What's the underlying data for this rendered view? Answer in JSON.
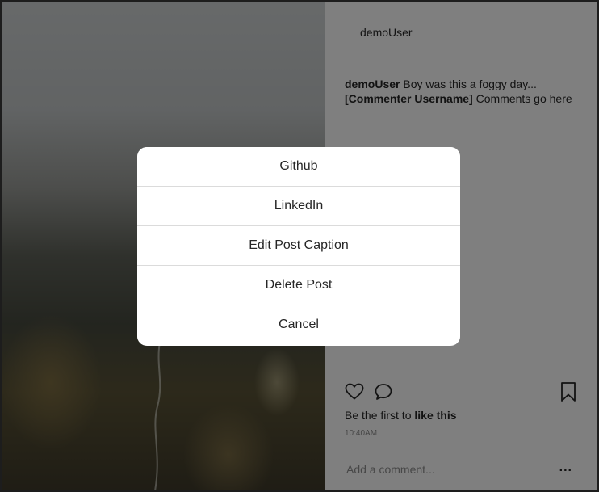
{
  "post": {
    "username": "demoUser",
    "caption": "Boy was this a foggy day...",
    "comment": {
      "username": "[Commenter Username]",
      "text": "Comments go here"
    },
    "likes": {
      "prefix": "Be the first to",
      "action": "like this"
    },
    "timestamp": "10:40AM",
    "comment_input": {
      "placeholder": "Add a comment...",
      "value": ""
    },
    "more_label": "..."
  },
  "icons": {
    "like": "heart-icon",
    "comment": "comment-bubble-icon",
    "save": "bookmark-icon"
  },
  "modal": {
    "items": [
      {
        "label": "Github"
      },
      {
        "label": "LinkedIn"
      },
      {
        "label": "Edit Post Caption"
      },
      {
        "label": "Delete Post"
      },
      {
        "label": "Cancel"
      }
    ]
  },
  "colors": {
    "text": "#262626",
    "muted": "#8e8e8e",
    "divider": "#efefef",
    "overlay": "rgba(0,0,0,0.5)",
    "modal_bg": "#ffffff"
  }
}
